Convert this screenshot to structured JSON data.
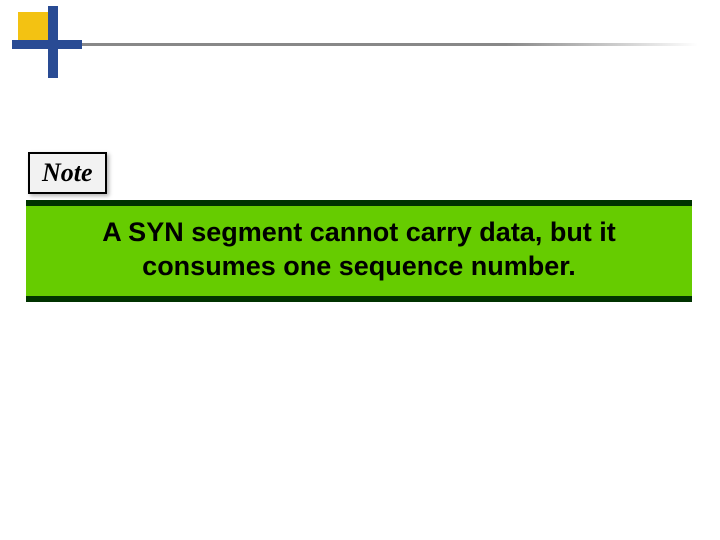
{
  "note": {
    "label": "Note"
  },
  "banner": {
    "text": "A SYN segment cannot carry data, but it consumes one sequence number."
  },
  "colors": {
    "banner_bg": "#66cc00",
    "banner_border": "#003300",
    "accent_yellow": "#f3c212",
    "accent_blue": "#294b94"
  }
}
